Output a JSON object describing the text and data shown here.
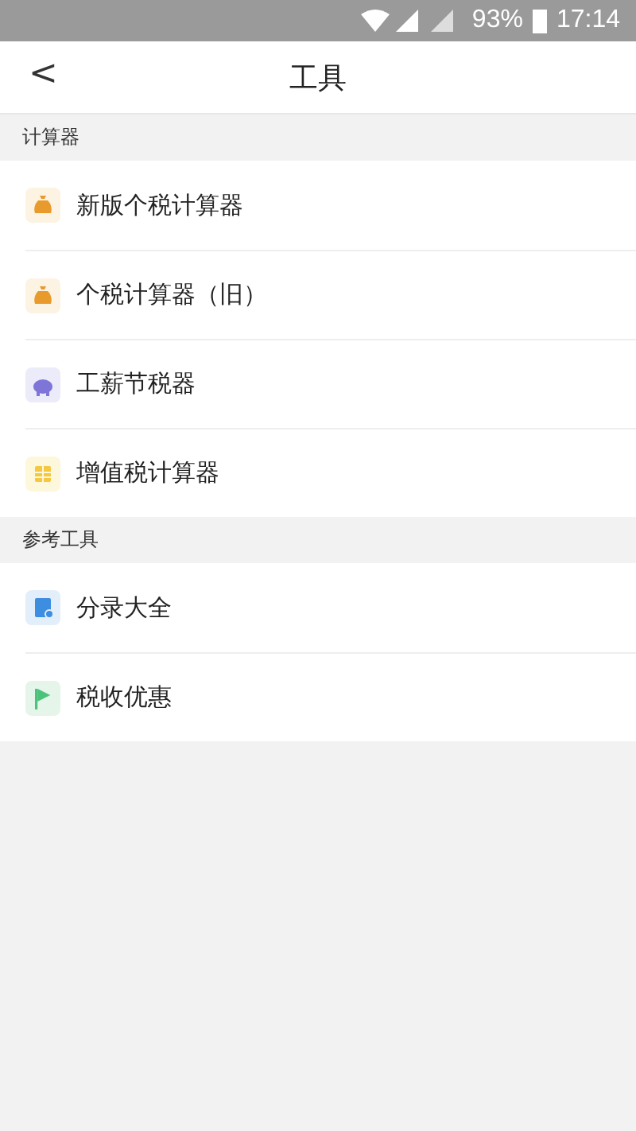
{
  "status_bar": {
    "battery": "93%",
    "time": "17:14"
  },
  "header": {
    "back": "<",
    "title": "工具"
  },
  "sections": [
    {
      "title": "计算器",
      "items": [
        {
          "kind": "moneybag",
          "label": "新版个税计算器"
        },
        {
          "kind": "moneybag",
          "label": "个税计算器（旧）"
        },
        {
          "kind": "piggy",
          "label": "工薪节税器"
        },
        {
          "kind": "calendar",
          "label": "增值税计算器"
        }
      ]
    },
    {
      "title": "参考工具",
      "items": [
        {
          "kind": "clipboard",
          "label": "分录大全"
        },
        {
          "kind": "flag",
          "label": "税收优惠"
        }
      ]
    }
  ]
}
